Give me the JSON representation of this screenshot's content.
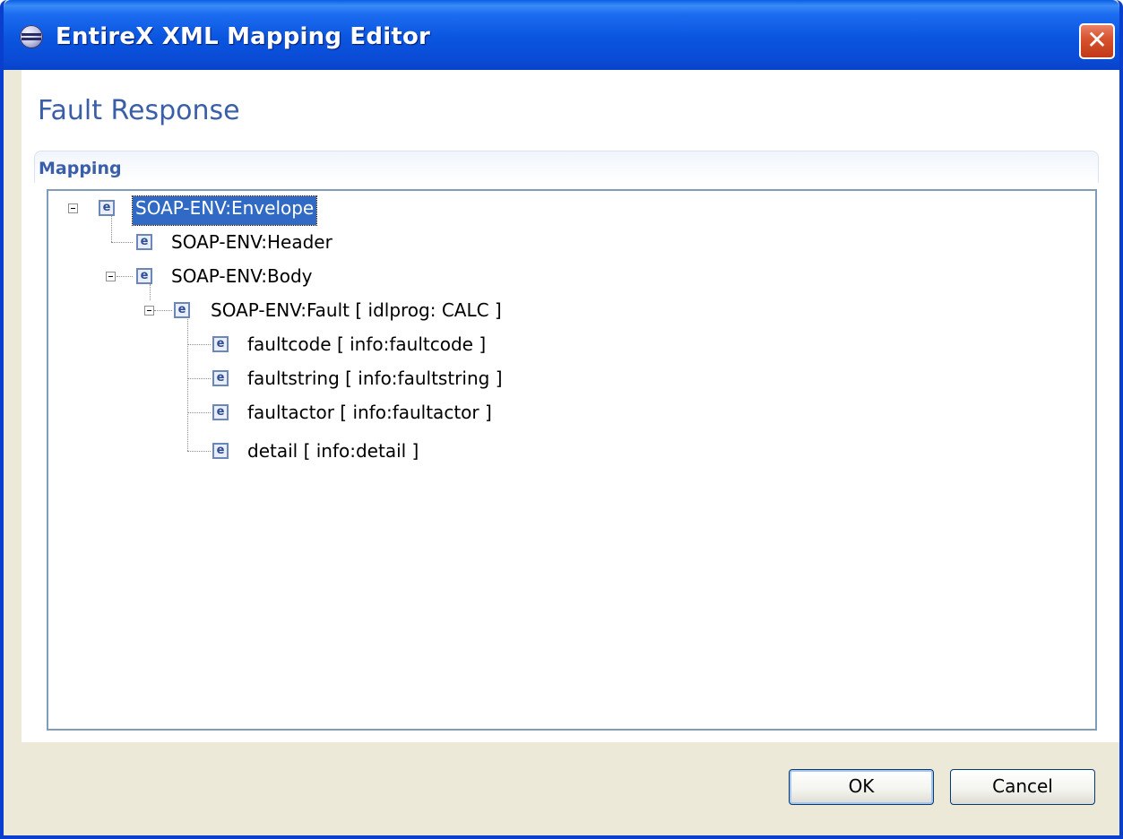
{
  "window": {
    "title": "EntireX XML Mapping Editor",
    "icon": "eclipse-icon",
    "close_glyph": "✕"
  },
  "page": {
    "title": "Fault Response"
  },
  "section": {
    "title": "Mapping"
  },
  "tree": {
    "nodes": [
      {
        "label": "SOAP-ENV:Envelope",
        "icon": "e",
        "selected": true,
        "expanded": true
      },
      {
        "label": "SOAP-ENV:Header",
        "icon": "e"
      },
      {
        "label": "SOAP-ENV:Body",
        "icon": "e",
        "expanded": true
      },
      {
        "label": "SOAP-ENV:Fault  [ idlprog: CALC ]",
        "icon": "e",
        "expanded": true
      },
      {
        "label": "faultcode [ info:faultcode ]",
        "icon": "e"
      },
      {
        "label": "faultstring [ info:faultstring ]",
        "icon": "e"
      },
      {
        "label": "faultactor [ info:faultactor ]",
        "icon": "e"
      },
      {
        "label": "detail [ info:detail ]",
        "icon": "e"
      }
    ]
  },
  "buttons": {
    "ok": "OK",
    "cancel": "Cancel"
  },
  "colors": {
    "titlebar": "#0a55df",
    "accent_text": "#3a5fa8",
    "selection": "#316ac5"
  }
}
